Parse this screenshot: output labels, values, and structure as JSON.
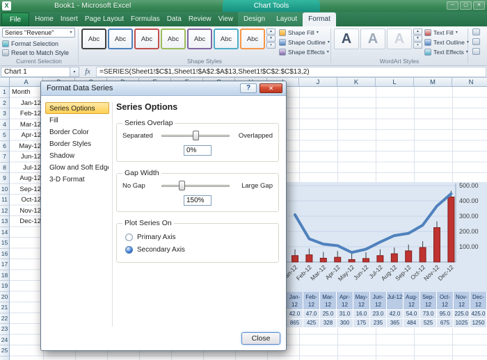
{
  "icons": {
    "dropdown": "▾",
    "gallery_up": "▲",
    "gallery_down": "▼",
    "gallery_more": "▾",
    "window_minimize": "─",
    "window_maximize": "▢",
    "window_close": "✕"
  },
  "window": {
    "title": "Book1 - Microsoft Excel",
    "contextual_group": "Chart Tools"
  },
  "ribbon": {
    "tabs": [
      "File",
      "Home",
      "Insert",
      "Page Layout",
      "Formulas",
      "Data",
      "Review",
      "View"
    ],
    "contextual_tabs": [
      "Design",
      "Layout",
      "Format"
    ],
    "active_tab": "Format",
    "groups": {
      "current_selection": {
        "label": "Current Selection",
        "selector_value": "Series \"Revenue\"",
        "buttons": [
          "Format Selection",
          "Reset to Match Style"
        ]
      },
      "shape_styles": {
        "label": "Shape Styles",
        "thumb_text": "Abc",
        "thumb_colors": [
          "#3f3f3f",
          "#4f81bd",
          "#c0504d",
          "#9bbb59",
          "#8064a2",
          "#4bacc6",
          "#f79646"
        ],
        "buttons": [
          "Shape Fill",
          "Shape Outline",
          "Shape Effects"
        ]
      },
      "wordart_styles": {
        "label": "WordArt Styles",
        "letter": "A",
        "buttons": [
          "Text Fill",
          "Text Outline",
          "Text Effects"
        ]
      }
    }
  },
  "formula_bar": {
    "name_box": "Chart 1",
    "fx": "fx",
    "formula": "=SERIES(Sheet1!$C$1,Sheet1!$A$2:$A$13,Sheet1!$C$2:$C$13,2)"
  },
  "sheet": {
    "column_headers": [
      "A",
      "B",
      "C",
      "D",
      "E",
      "F",
      "G",
      "H",
      "I",
      "J",
      "K",
      "L",
      "M",
      "N"
    ],
    "row_count": 25,
    "a1": "Month",
    "months": [
      "Jan-12",
      "Feb-12",
      "Mar-12",
      "Apr-12",
      "May-12",
      "Jun-12",
      "Jul-12",
      "Aug-12",
      "Sep-12",
      "Oct-12",
      "Nov-12",
      "Dec-12"
    ]
  },
  "dialog": {
    "title": "Format Data Series",
    "help_icon": "?",
    "close_icon": "✕",
    "nav_items": [
      "Series Options",
      "Fill",
      "Border Color",
      "Border Styles",
      "Shadow",
      "Glow and Soft Edges",
      "3-D Format"
    ],
    "active_nav": "Series Options",
    "heading": "Series Options",
    "sections": {
      "overlap": {
        "title": "Series Overlap",
        "min_label": "Separated",
        "max_label": "Overlapped",
        "value": "0%",
        "thumb_pct": 50
      },
      "gap": {
        "title": "Gap Width",
        "min_label": "No Gap",
        "max_label": "Large Gap",
        "value": "150%",
        "thumb_pct": 30
      },
      "axis": {
        "title": "Plot Series On",
        "options": [
          {
            "label": "Primary Axis",
            "selected": false
          },
          {
            "label": "Secondary Axis",
            "selected": true
          }
        ]
      }
    },
    "close_button": "Close"
  },
  "chart_data": {
    "type": "combo",
    "categories": [
      "Jan-12",
      "Feb-12",
      "Mar-12",
      "Apr-12",
      "May-12",
      "Jun-12",
      "Jul-12",
      "Aug-12",
      "Sep-12",
      "Oct-12",
      "Nov-12",
      "Dec-12"
    ],
    "series": [
      {
        "name": "",
        "type": "line",
        "axis": "primary",
        "color": "#4f81bd",
        "values": [
          865,
          425,
          328,
          300,
          175,
          235,
          365,
          484,
          525,
          675,
          1025,
          1250
        ]
      },
      {
        "name": "Revenue",
        "type": "bar",
        "axis": "secondary",
        "color": "#bf3330",
        "values": [
          42,
          47,
          25,
          31,
          16,
          23,
          42,
          54,
          73,
          95,
          225,
          425
        ]
      }
    ],
    "primary_ylim": [
      0,
      1400
    ],
    "secondary_ylim": [
      0,
      500
    ],
    "secondary_axis_ticks": [
      "500.00",
      "400.00",
      "300.00",
      "200.00",
      "100.00"
    ],
    "grid": true,
    "legend": "none",
    "data_table_rows": [
      [
        "42.0",
        "47.0",
        "25.0",
        "31.0",
        "16.0",
        "23.0",
        "42.0",
        "54.0",
        "73.0",
        "95.0",
        "225.0",
        "425.0"
      ],
      [
        "865",
        "425",
        "328",
        "300",
        "175",
        "235",
        "365",
        "484",
        "525",
        "675",
        "1025",
        "1250"
      ]
    ]
  }
}
